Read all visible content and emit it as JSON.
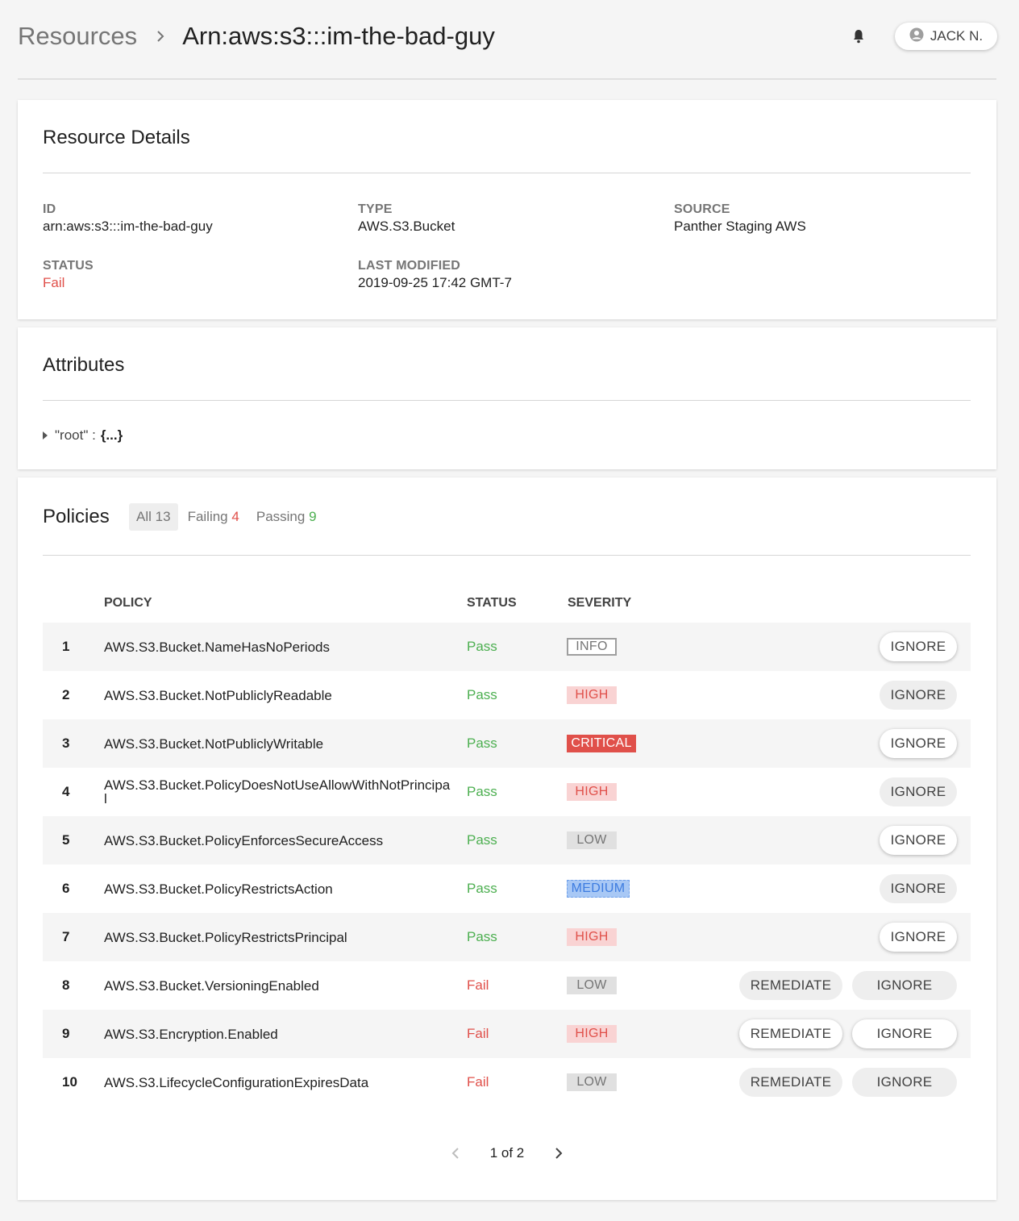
{
  "header": {
    "breadcrumb_root": "Resources",
    "breadcrumb_current": "Arn:aws:s3:::im-the-bad-guy",
    "user_name": "JACK N."
  },
  "details": {
    "title": "Resource Details",
    "id_label": "ID",
    "id_value": "arn:aws:s3:::im-the-bad-guy",
    "type_label": "TYPE",
    "type_value": "AWS.S3.Bucket",
    "source_label": "SOURCE",
    "source_value": "Panther Staging AWS",
    "status_label": "STATUS",
    "status_value": "Fail",
    "modified_label": "LAST MODIFIED",
    "modified_value": "2019-09-25 17:42 GMT-7"
  },
  "attributes": {
    "title": "Attributes",
    "root_key": "\"root\" :",
    "root_value": "{...}"
  },
  "policies": {
    "title": "Policies",
    "filters": {
      "all_label": "All",
      "all_count": "13",
      "failing_label": "Failing",
      "failing_count": "4",
      "passing_label": "Passing",
      "passing_count": "9"
    },
    "columns": {
      "policy": "POLICY",
      "status": "STATUS",
      "severity": "SEVERITY"
    },
    "actions": {
      "ignore": "IGNORE",
      "remediate": "REMEDIATE"
    },
    "rows": [
      {
        "num": "1",
        "policy": "AWS.S3.Bucket.NameHasNoPeriods",
        "status": "Pass",
        "severity": "INFO"
      },
      {
        "num": "2",
        "policy": "AWS.S3.Bucket.NotPubliclyReadable",
        "status": "Pass",
        "severity": "HIGH"
      },
      {
        "num": "3",
        "policy": "AWS.S3.Bucket.NotPubliclyWritable",
        "status": "Pass",
        "severity": "CRITICAL"
      },
      {
        "num": "4",
        "policy": "AWS.S3.Bucket.PolicyDoesNotUseAllowWithNotPrincipal",
        "status": "Pass",
        "severity": "HIGH"
      },
      {
        "num": "5",
        "policy": "AWS.S3.Bucket.PolicyEnforcesSecureAccess",
        "status": "Pass",
        "severity": "LOW"
      },
      {
        "num": "6",
        "policy": "AWS.S3.Bucket.PolicyRestrictsAction",
        "status": "Pass",
        "severity": "MEDIUM"
      },
      {
        "num": "7",
        "policy": "AWS.S3.Bucket.PolicyRestrictsPrincipal",
        "status": "Pass",
        "severity": "HIGH"
      },
      {
        "num": "8",
        "policy": "AWS.S3.Bucket.VersioningEnabled",
        "status": "Fail",
        "severity": "LOW"
      },
      {
        "num": "9",
        "policy": "AWS.S3.Encryption.Enabled",
        "status": "Fail",
        "severity": "HIGH"
      },
      {
        "num": "10",
        "policy": "AWS.S3.LifecycleConfigurationExpiresData",
        "status": "Fail",
        "severity": "LOW"
      }
    ],
    "pagination": "1 of 2"
  },
  "icons": {
    "bell": "bell-icon",
    "user": "user-circle-icon",
    "breadcrumb_separator": "chevron-right-icon",
    "prev": "chevron-left-icon",
    "next": "chevron-right-icon",
    "expand": "caret-right-icon"
  },
  "colors": {
    "fail": "#e0504a",
    "pass": "#4caf50",
    "high_bg": "#f9d3d3",
    "critical_bg": "#e0504a",
    "low_bg": "#e0e0e0",
    "medium_bg": "#a8c8f5"
  }
}
